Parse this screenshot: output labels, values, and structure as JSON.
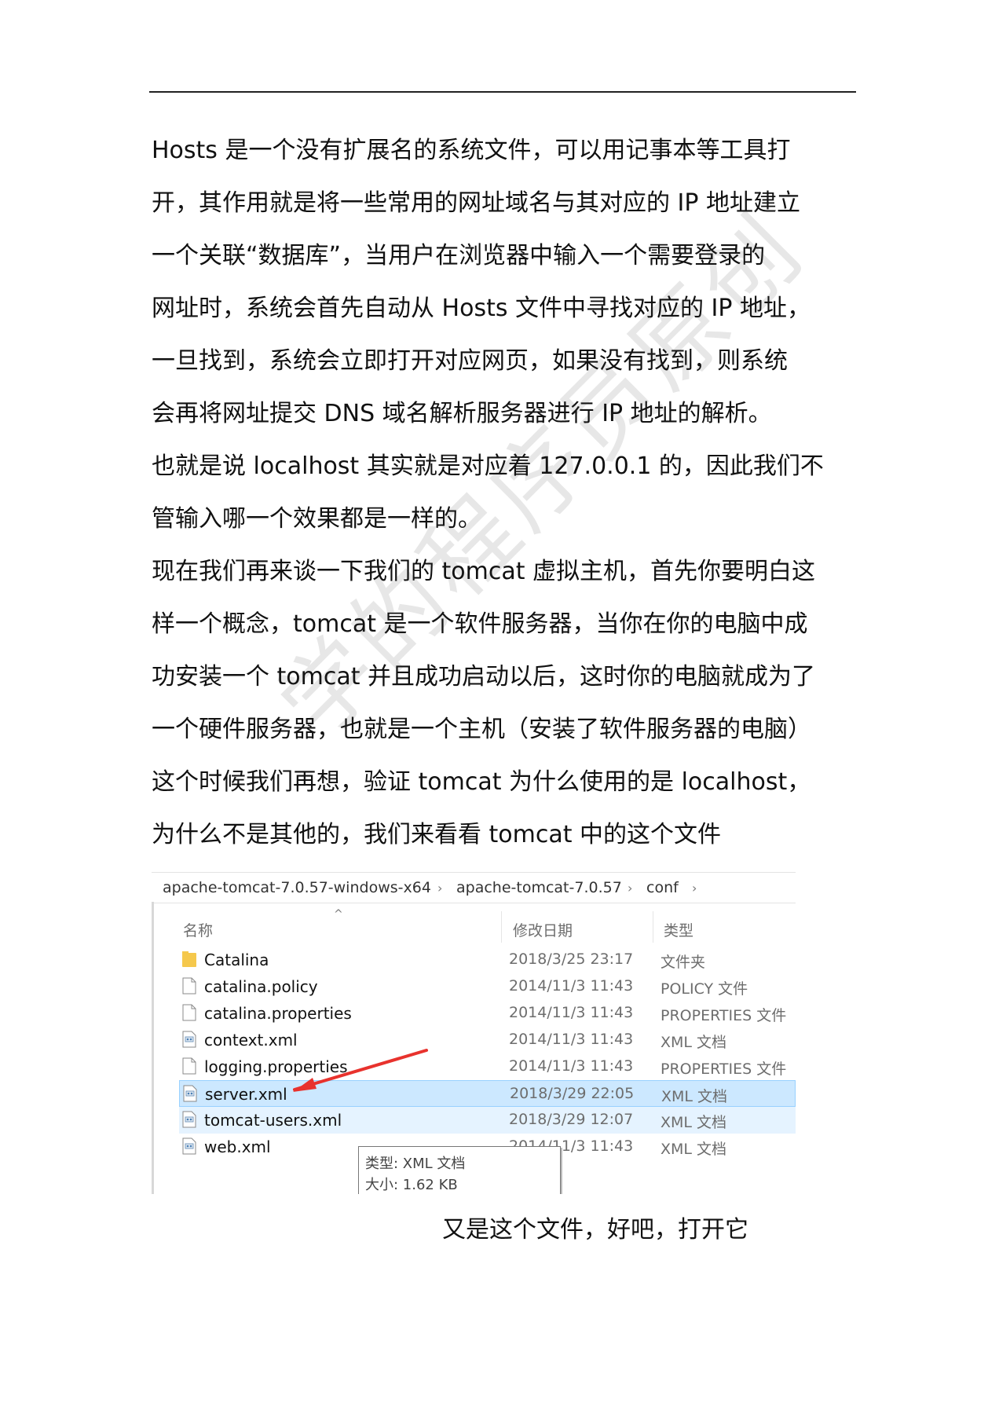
{
  "body": {
    "lines": [
      "Hosts 是一个没有扩展名的系统文件，可以用记事本等工具打",
      "开，其作用就是将一些常用的网址域名与其对应的 IP 地址建立",
      "一个关联“数据库”，当用户在浏览器中输入一个需要登录的",
      "网址时，系统会首先自动从 Hosts 文件中寻找对应的 IP 地址，",
      "一旦找到，系统会立即打开对应网页，如果没有找到，则系统",
      "会再将网址提交 DNS 域名解析服务器进行 IP 地址的解析。",
      "也就是说 localhost 其实就是对应着 127.0.0.1 的，因此我们不",
      "管输入哪一个效果都是一样的。",
      "现在我们再来谈一下我们的 tomcat 虚拟主机，首先你要明白这",
      "样一个概念，tomcat 是一个软件服务器，当你在你的电脑中成",
      "功安装一个 tomcat 并且成功启动以后，这时你的电脑就成为了",
      "一个硬件服务器，也就是一个主机（安装了软件服务器的电脑）",
      "这个时候我们再想，验证 tomcat 为什么使用的是 localhost，",
      "为什么不是其他的，我们来看看 tomcat 中的这个文件"
    ]
  },
  "watermark": "学的程序员原创",
  "explorer": {
    "breadcrumb": [
      "apache-tomcat-7.0.57-windows-x64",
      "apache-tomcat-7.0.57",
      "conf"
    ],
    "columns": {
      "name": "名称",
      "date": "修改日期",
      "type": "类型"
    },
    "files": [
      {
        "name": "Catalina",
        "date": "2018/3/25 23:17",
        "type": "文件夹",
        "icon": "folder-icon"
      },
      {
        "name": "catalina.policy",
        "date": "2014/11/3 11:43",
        "type": "POLICY 文件",
        "icon": "file-icon"
      },
      {
        "name": "catalina.properties",
        "date": "2014/11/3 11:43",
        "type": "PROPERTIES 文件",
        "icon": "file-icon"
      },
      {
        "name": "context.xml",
        "date": "2014/11/3 11:43",
        "type": "XML 文档",
        "icon": "xml-file-icon"
      },
      {
        "name": "logging.properties",
        "date": "2014/11/3 11:43",
        "type": "PROPERTIES 文件",
        "icon": "file-icon"
      },
      {
        "name": "server.xml",
        "date": "2018/3/29 22:05",
        "type": "XML 文档",
        "icon": "xml-file-icon",
        "state": "selected"
      },
      {
        "name": "tomcat-users.xml",
        "date": "2018/3/29 12:07",
        "type": "XML 文档",
        "icon": "xml-file-icon",
        "state": "hover"
      },
      {
        "name": "web.xml",
        "date": "2014/11/3 11:43",
        "type": "XML 文档",
        "icon": "xml-file-icon"
      }
    ],
    "tooltip": {
      "type_line": "类型: XML 文档",
      "size_line": "大小: 1.62 KB"
    },
    "colors": {
      "selected_bg": "#cce8ff",
      "hover_bg": "#e5f3ff",
      "arrow": "#e8322d",
      "folder": "#f5c84c"
    }
  },
  "caption": "又是这个文件，好吧，打开它"
}
